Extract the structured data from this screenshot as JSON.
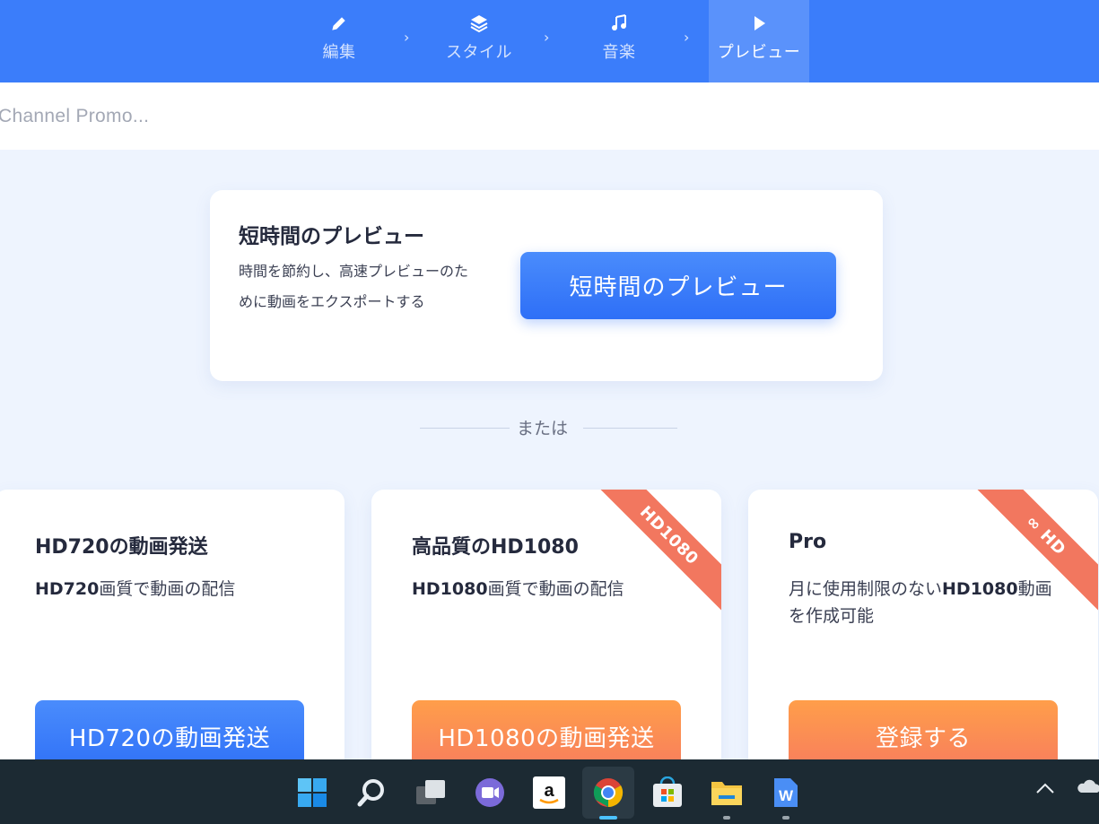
{
  "stepper": {
    "steps": [
      {
        "label": "編集",
        "icon": "pencil-icon"
      },
      {
        "label": "スタイル",
        "icon": "layers-icon"
      },
      {
        "label": "音楽",
        "icon": "music-note-icon"
      },
      {
        "label": "プレビュー",
        "icon": "play-icon"
      }
    ],
    "separator": "›",
    "active_index": 3
  },
  "project": {
    "title": "Channel Promo..."
  },
  "short_preview": {
    "title": "短時間のプレビュー",
    "description": "時間を節約し、高速プレビューのために動画をエクスポートする",
    "button_label": "短時間のプレビュー"
  },
  "divider": {
    "text": "または"
  },
  "plans": [
    {
      "title": "HD720の動画発送",
      "desc_bold": "HD720",
      "desc_rest": "画質で動画の配信",
      "desc_after": "",
      "button_label": "HD720の動画発送",
      "button_color": "#3b7dfa"
    },
    {
      "title": "高品質のHD1080",
      "ribbon": "HD1080",
      "desc_bold": "HD1080",
      "desc_rest": "画質で動画の配信",
      "desc_after": "",
      "button_label": "HD1080の動画発送",
      "button_color": "#f98a52"
    },
    {
      "title": "Pro",
      "ribbon": "∞ HD",
      "desc_before": "月に使用制限のない",
      "desc_bold": "HD1080",
      "desc_rest": "動画を作成可能",
      "button_label": "登録する",
      "button_color": "#f98a52"
    }
  ],
  "colors": {
    "header_blue": "#3b7dfa",
    "ribbon_coral": "#f2775f",
    "page_bg": "#eef4fe"
  },
  "taskbar": {
    "apps": [
      "windows-start-icon",
      "search-icon",
      "task-view-icon",
      "teams-chat-icon",
      "amazon-icon",
      "chrome-icon",
      "microsoft-store-icon",
      "file-explorer-icon",
      "word-icon"
    ],
    "tray": [
      "chevron-up-icon",
      "onedrive-cloud-icon"
    ]
  }
}
